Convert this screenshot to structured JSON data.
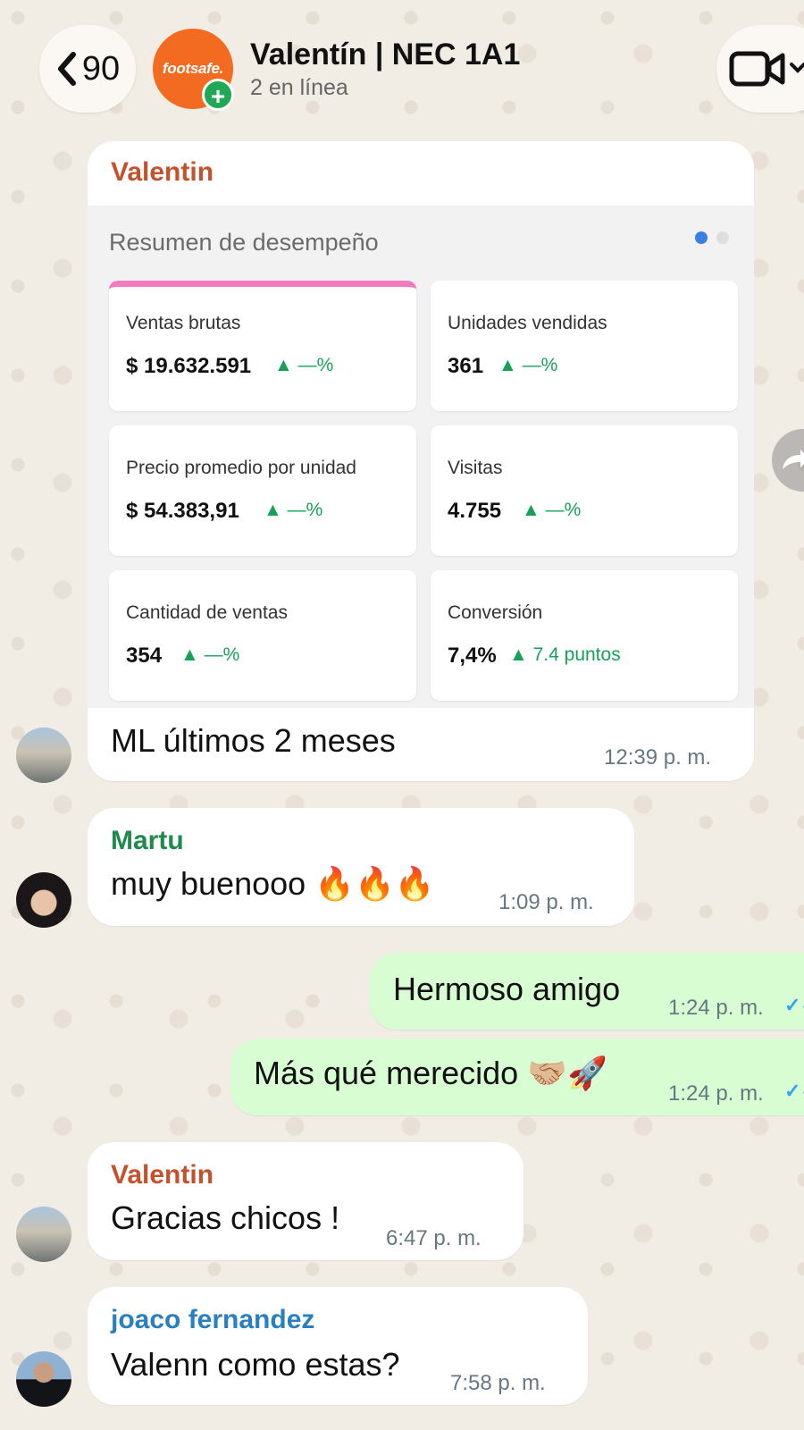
{
  "header": {
    "back_count": "90",
    "group_avatar_text": "footsafe.",
    "title": "Valentín | NEC 1A1",
    "subtitle": "2 en línea"
  },
  "messages": [
    {
      "sender": "Valentin",
      "sender_color": "#c4512b",
      "card": {
        "title": "Resumen de desempeño",
        "metrics": [
          {
            "label": "Ventas brutas",
            "value": "$ 19.632.591",
            "change": "▲ —%"
          },
          {
            "label": "Unidades vendidas",
            "value": "361",
            "change": "▲ —%"
          },
          {
            "label": "Precio promedio por unidad",
            "value": "$ 54.383,91",
            "change": "▲ —%"
          },
          {
            "label": "Visitas",
            "value": "4.755",
            "change": "▲ —%"
          },
          {
            "label": "Cantidad de ventas",
            "value": "354",
            "change": "▲ —%"
          },
          {
            "label": "Conversión",
            "value": "7,4%",
            "change": "▲ 7.4 puntos"
          }
        ]
      },
      "text": "ML últimos 2 meses",
      "time": "12:39 p. m."
    },
    {
      "sender": "Martu",
      "sender_color": "#1f8a4c",
      "text": "muy buenooo 🔥🔥🔥",
      "time": "1:09 p. m."
    },
    {
      "text": "Hermoso amigo",
      "time": "1:24 p. m.",
      "outgoing": true
    },
    {
      "text": "Más qué merecido 🤝🏼🚀",
      "time": "1:24 p. m.",
      "outgoing": true
    },
    {
      "sender": "Valentin",
      "sender_color": "#c4512b",
      "text": "Gracias chicos !",
      "time": "6:47 p. m."
    },
    {
      "sender": "joaco fernandez",
      "sender_color": "#2a7fc0",
      "text": "Valenn como estas?",
      "time": "7:58 p. m."
    }
  ],
  "colors": {
    "outgoing_bubble": "#d9fdd3",
    "read_tick": "#34a4f0",
    "positive_change": "#16a05a",
    "highlight_bar": "#f27bbf"
  }
}
